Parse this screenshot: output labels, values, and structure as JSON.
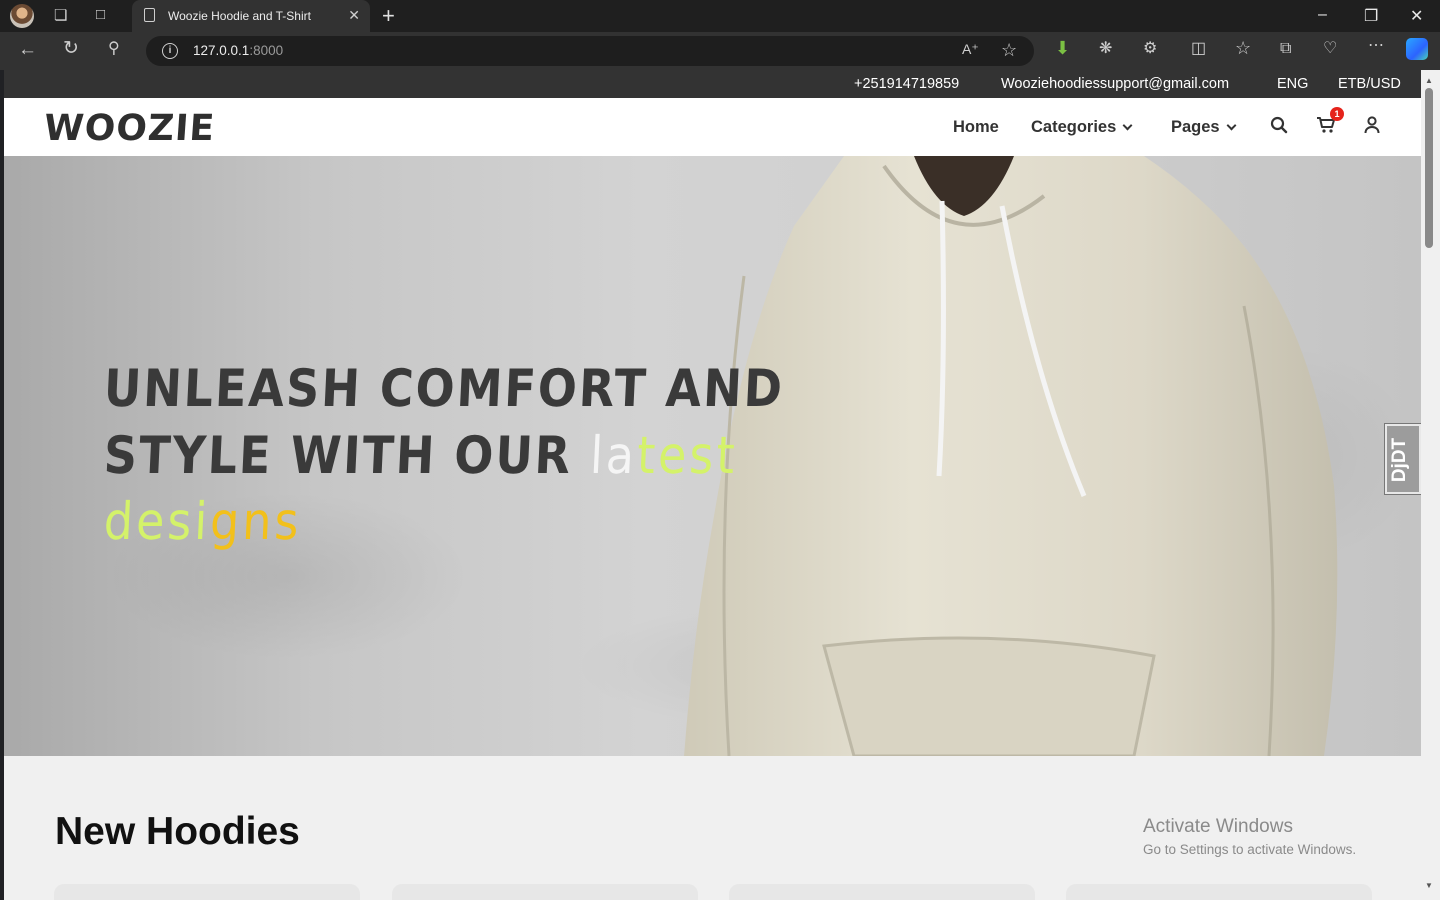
{
  "browser": {
    "tab_title": "Woozie Hoodie and T-Shirt",
    "url_host": "127.0.0.1",
    "url_port": ":8000"
  },
  "topbar": {
    "phone": "+251914719859",
    "email": "Wooziehoodiessupport@gmail.com",
    "language": "ENG",
    "currency": "ETB/USD"
  },
  "navbar": {
    "logo": "WOOZIE",
    "home": "Home",
    "categories": "Categories",
    "pages": "Pages",
    "cart_count": "1"
  },
  "hero": {
    "line1": "UNLEASH COMFORT AND",
    "line2": "STYLE WITH OUR",
    "accent_word1": "latest",
    "accent_word2": "designs",
    "colors": {
      "white": "#f5f5f5",
      "lime": "#d4f26a",
      "gold": "#f2c01b"
    }
  },
  "debug_toolbar": {
    "label": "DjDT"
  },
  "section": {
    "title": "New Hoodies"
  },
  "watermark": {
    "line1": "Activate Windows",
    "line2": "Go to Settings to activate Windows."
  }
}
